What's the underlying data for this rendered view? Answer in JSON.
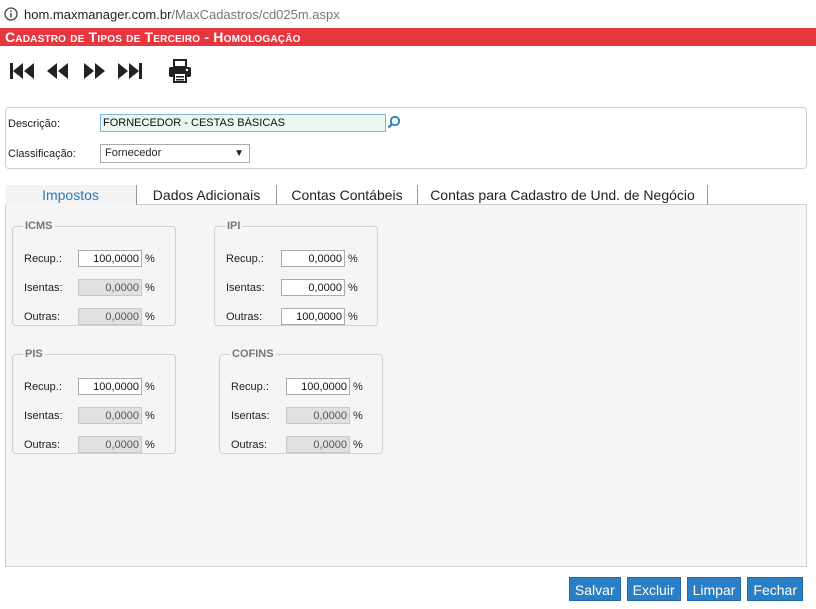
{
  "browser": {
    "url_host": "hom.maxmanager.com.br",
    "url_path": "/MaxCadastros/cd025m.aspx"
  },
  "window": {
    "title": "Cadastro de Tipos de Terceiro  - Homologação"
  },
  "form": {
    "descricao_label": "Descrição:",
    "descricao_value": "FORNECEDOR - CESTAS BÁSICAS",
    "classificacao_label": "Classificação:",
    "classificacao_value": "Fornecedor"
  },
  "tabs": [
    {
      "label": "Impostos",
      "active": true
    },
    {
      "label": "Dados Adicionais",
      "active": false
    },
    {
      "label": "Contas Contábeis",
      "active": false
    },
    {
      "label": "Contas para Cadastro de Und. de Negócio",
      "active": false
    }
  ],
  "labels": {
    "recup": "Recup.:",
    "isentas": "Isentas:",
    "outras": "Outras:",
    "pct": "%"
  },
  "taxes": {
    "icms": {
      "title": "ICMS",
      "recup": "100,0000",
      "isentas": "0,0000",
      "outras": "0,0000"
    },
    "ipi": {
      "title": "IPI",
      "recup": "0,0000",
      "isentas": "0,0000",
      "outras": "100,0000"
    },
    "pis": {
      "title": "PIS",
      "recup": "100,0000",
      "isentas": "0,0000",
      "outras": "0,0000"
    },
    "cofins": {
      "title": "COFINS",
      "recup": "100,0000",
      "isentas": "0,0000",
      "outras": "0,0000"
    }
  },
  "buttons": {
    "save": "Salvar",
    "delete": "Excluir",
    "clear": "Limpar",
    "close": "Fechar"
  }
}
